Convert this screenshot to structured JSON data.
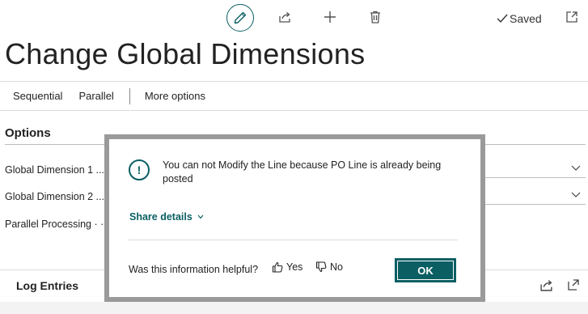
{
  "toolbar": {
    "edit_icon": "pencil-icon",
    "share_icon": "share-icon",
    "add_icon": "plus-icon",
    "delete_icon": "trash-icon",
    "saved_label": "Saved",
    "popout_icon": "open-in-new-window-icon"
  },
  "page": {
    "title": "Change Global Dimensions"
  },
  "actions": {
    "sequential": "Sequential",
    "parallel": "Parallel",
    "more_options": "More options"
  },
  "options": {
    "section_title": "Options",
    "fields": [
      {
        "label": "Global Dimension 1 ..."
      },
      {
        "label": "Global Dimension 2 ..."
      },
      {
        "label": "Parallel Processing · · ·"
      }
    ]
  },
  "log": {
    "title": "Log Entries"
  },
  "dialog": {
    "message": "You can not Modify the Line because PO Line is already being posted",
    "share_details": "Share details",
    "helpful_question": "Was this information helpful?",
    "yes_label": "Yes",
    "no_label": "No",
    "ok_label": "OK"
  },
  "colors": {
    "accent": "#0b5f63",
    "overlay_frame": "#9a9a9a"
  }
}
